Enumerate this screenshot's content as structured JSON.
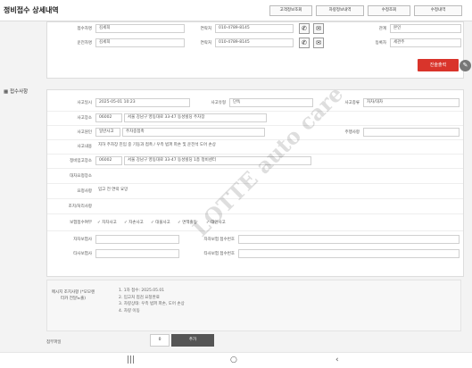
{
  "header": {
    "title": "정비접수 상세내역",
    "buttons": [
      "고객정보조회",
      "차량정보내역",
      "수정조회",
      "수정내역"
    ]
  },
  "customer": {
    "rows": [
      {
        "label1": "접수자명",
        "value1": "김세희",
        "label2": "연락처",
        "value2": "010-4789-8145",
        "label3": "관계",
        "value3": "본인"
      },
      {
        "label1": "운전자명",
        "value1": "김세희",
        "label2": "연락처",
        "value2": "010-4789-8145",
        "label3": "등록자",
        "value3": "세관주"
      }
    ],
    "red_button": "진술출력"
  },
  "section_label": "접수사항",
  "form": {
    "accident_date_label": "사고일시",
    "accident_date": "2025-05-01 10:23",
    "accident_type_label": "사고유형",
    "accident_type": "단독",
    "accident_kind_label": "사고종류",
    "accident_kind": "자차/대차",
    "accident_place_label": "사고장소",
    "accident_zip": "06002",
    "accident_addr": "서울 강남구 영동대로 33-47 동성빌딩 주차장",
    "accident_detail_label": "사고원인",
    "accident_detail": "일반사고",
    "accident_detail2": "주차중접촉",
    "accident_detail3_label": "주행사항",
    "accident_detail3": "",
    "accident_content_label": "사고내용",
    "accident_content": "지하 주차장 진입 중 기둥과 접촉 / 우측 범퍼 파손 및 운전석 도어 손상",
    "repair_place_label": "정비입고장소",
    "repair_zip": "06002",
    "repair_addr": "서울 강남구 영동대로 33-47 동성빌딩 1층 정비센터",
    "pickup_label": "대차요청장소",
    "pickup": "",
    "request_label": "요청사항",
    "request": "입고 전 연락 요망",
    "emergency_label": "조치/처리사항",
    "emergency": "",
    "insurance_label": "보험접수여부",
    "checks": [
      "자차사고",
      "자손사고",
      "대물사고",
      "면책출동",
      "대인사고"
    ],
    "self_ins_label": "자차보험사",
    "self_ins": "",
    "self_ins_no_label": "자차보험 접수번호",
    "self_ins_no": "",
    "other_ins_label": "타사보험사",
    "other_ins": "",
    "other_ins_no_label": "타사보험 접수번호",
    "other_ins_no": ""
  },
  "memo": {
    "label": "메시지 조치사항 (*모모렌터카 전달노출)",
    "lines": [
      "1. 1차 접수: 2025.05.01",
      "2. 입고처 접검 요청완료",
      "3. 차량상태: 우측 범퍼 파손, 도어 손상",
      "4. 차량 이동"
    ]
  },
  "file": {
    "label": "첨부파일",
    "small": "0",
    "button": "추가"
  },
  "watermark": "LOTTE auto care"
}
